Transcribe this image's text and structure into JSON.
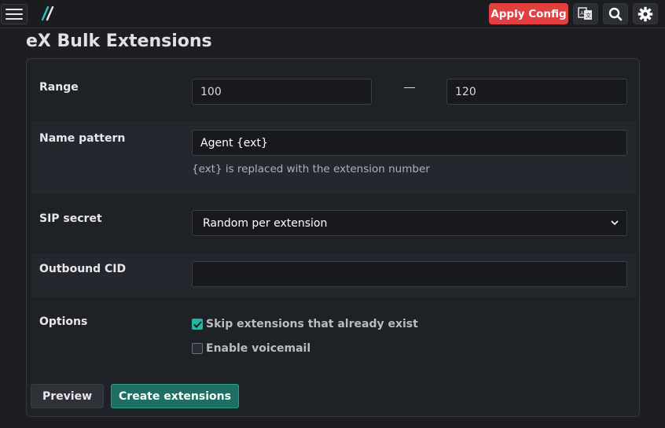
{
  "topbar": {
    "apply_label": "Apply Config",
    "icons": [
      "hamburger-icon",
      "logo-icon",
      "language-icon",
      "search-icon",
      "gear-icon"
    ],
    "accent": "#e0403f"
  },
  "page": {
    "title": "eX Bulk Extensions"
  },
  "form": {
    "range": {
      "label": "Range",
      "start": "100",
      "end": "120",
      "separator": "—"
    },
    "name_pattern": {
      "label": "Name pattern",
      "value": "Agent {ext}",
      "help": "{ext} is replaced with the extension number"
    },
    "sip_secret": {
      "label": "SIP secret",
      "selected": "Random per extension"
    },
    "outbound_cid": {
      "label": "Outbound CID",
      "value": ""
    },
    "options": {
      "label": "Options",
      "skip_existing": {
        "label": "Skip extensions that already exist",
        "checked": true
      },
      "voicemail": {
        "label": "Enable voicemail",
        "checked": false
      }
    }
  },
  "actions": {
    "preview_label": "Preview",
    "create_label": "Create extensions",
    "create_color": "#1e6f63"
  }
}
